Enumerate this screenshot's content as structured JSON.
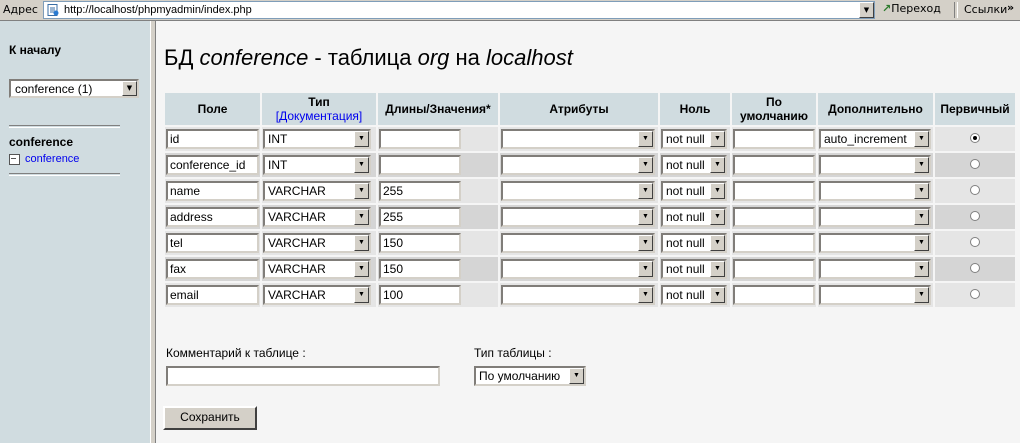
{
  "browser": {
    "address_label": "Адрес",
    "url": "http://localhost/phpmyadmin/index.php",
    "go_label": "Переход",
    "links_label": "Ссылки",
    "links_chevron": "»"
  },
  "left": {
    "home_link": "К началу",
    "db_select_value": "conference (1)",
    "db_name": "conference",
    "tables": [
      "conference"
    ]
  },
  "main": {
    "title": {
      "prefix": "БД ",
      "db": "conference",
      "middle": " - таблица ",
      "table": "org",
      "on": " на ",
      "host": "localhost"
    },
    "headers": {
      "field": "Поле",
      "type": "Тип",
      "type_doc": "[Документация]",
      "length": "Длины/Значения*",
      "attributes": "Атрибуты",
      "null": "Ноль",
      "default_line1": "По",
      "default_line2": "умолчанию",
      "extra": "Дополнительно",
      "primary": "Первичный"
    },
    "rows": [
      {
        "field": "id",
        "type": "INT",
        "length": "",
        "attributes": "",
        "null": "not null",
        "default": "",
        "extra": "auto_increment",
        "primary": true
      },
      {
        "field": "conference_id",
        "type": "INT",
        "length": "",
        "attributes": "",
        "null": "not null",
        "default": "",
        "extra": "",
        "primary": false
      },
      {
        "field": "name",
        "type": "VARCHAR",
        "length": "255",
        "attributes": "",
        "null": "not null",
        "default": "",
        "extra": "",
        "primary": false
      },
      {
        "field": "address",
        "type": "VARCHAR",
        "length": "255",
        "attributes": "",
        "null": "not null",
        "default": "",
        "extra": "",
        "primary": false
      },
      {
        "field": "tel",
        "type": "VARCHAR",
        "length": "150",
        "attributes": "",
        "null": "not null",
        "default": "",
        "extra": "",
        "primary": false
      },
      {
        "field": "fax",
        "type": "VARCHAR",
        "length": "150",
        "attributes": "",
        "null": "not null",
        "default": "",
        "extra": "",
        "primary": false
      },
      {
        "field": "email",
        "type": "VARCHAR",
        "length": "100",
        "attributes": "",
        "null": "not null",
        "default": "",
        "extra": "",
        "primary": false
      }
    ],
    "comment_label": "Комментарий к таблице :",
    "comment_value": "",
    "table_type_label": "Тип таблицы :",
    "table_type_value": "По умолчанию",
    "save_label": "Сохранить"
  }
}
